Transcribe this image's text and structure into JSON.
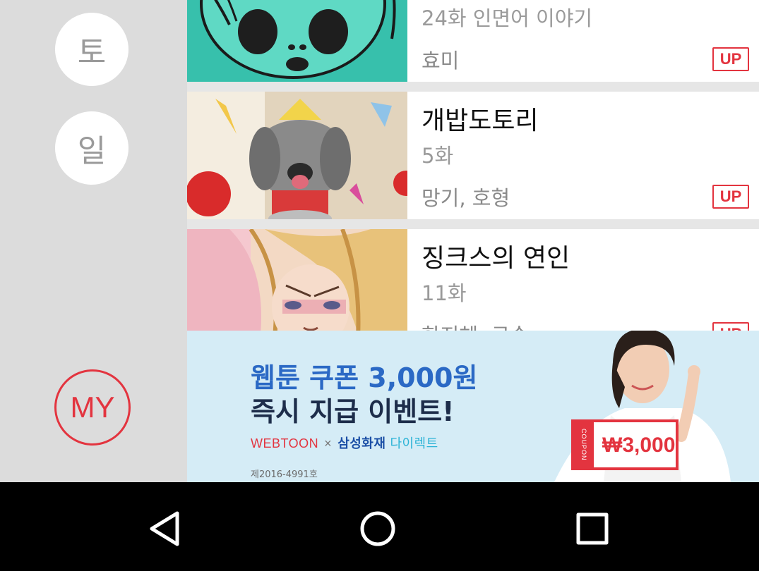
{
  "sidebar": {
    "days": [
      {
        "label": "토"
      },
      {
        "label": "일"
      }
    ],
    "my_label": "MY"
  },
  "list": [
    {
      "title": "",
      "episode": "24화 인면어 이야기",
      "author": "효미",
      "badge": "UP"
    },
    {
      "title": "개밥도토리",
      "episode": "5화",
      "author": "망기, 호형",
      "badge": "UP"
    },
    {
      "title": "징크스의 연인",
      "episode": "11화",
      "author": "한지혜, 구숙",
      "badge": "UP"
    }
  ],
  "banner": {
    "line1": "웹툰 쿠폰 3,000원",
    "line2": "즉시 지급 이벤트!",
    "brand": "WEBTOON",
    "x": "×",
    "partner": "삼성화재",
    "partner_sub": "다이렉트",
    "registration": "제2016-4991호",
    "coupon_side": "COUPON",
    "coupon_amount": "₩3,000"
  },
  "colors": {
    "accent": "#e3343f",
    "sidebar_bg": "#dcdcdc",
    "banner_bg": "#d5ecf6"
  },
  "navbar": {
    "back_icon": "back-triangle-icon",
    "home_icon": "home-circle-icon",
    "recents_icon": "recents-square-icon"
  }
}
